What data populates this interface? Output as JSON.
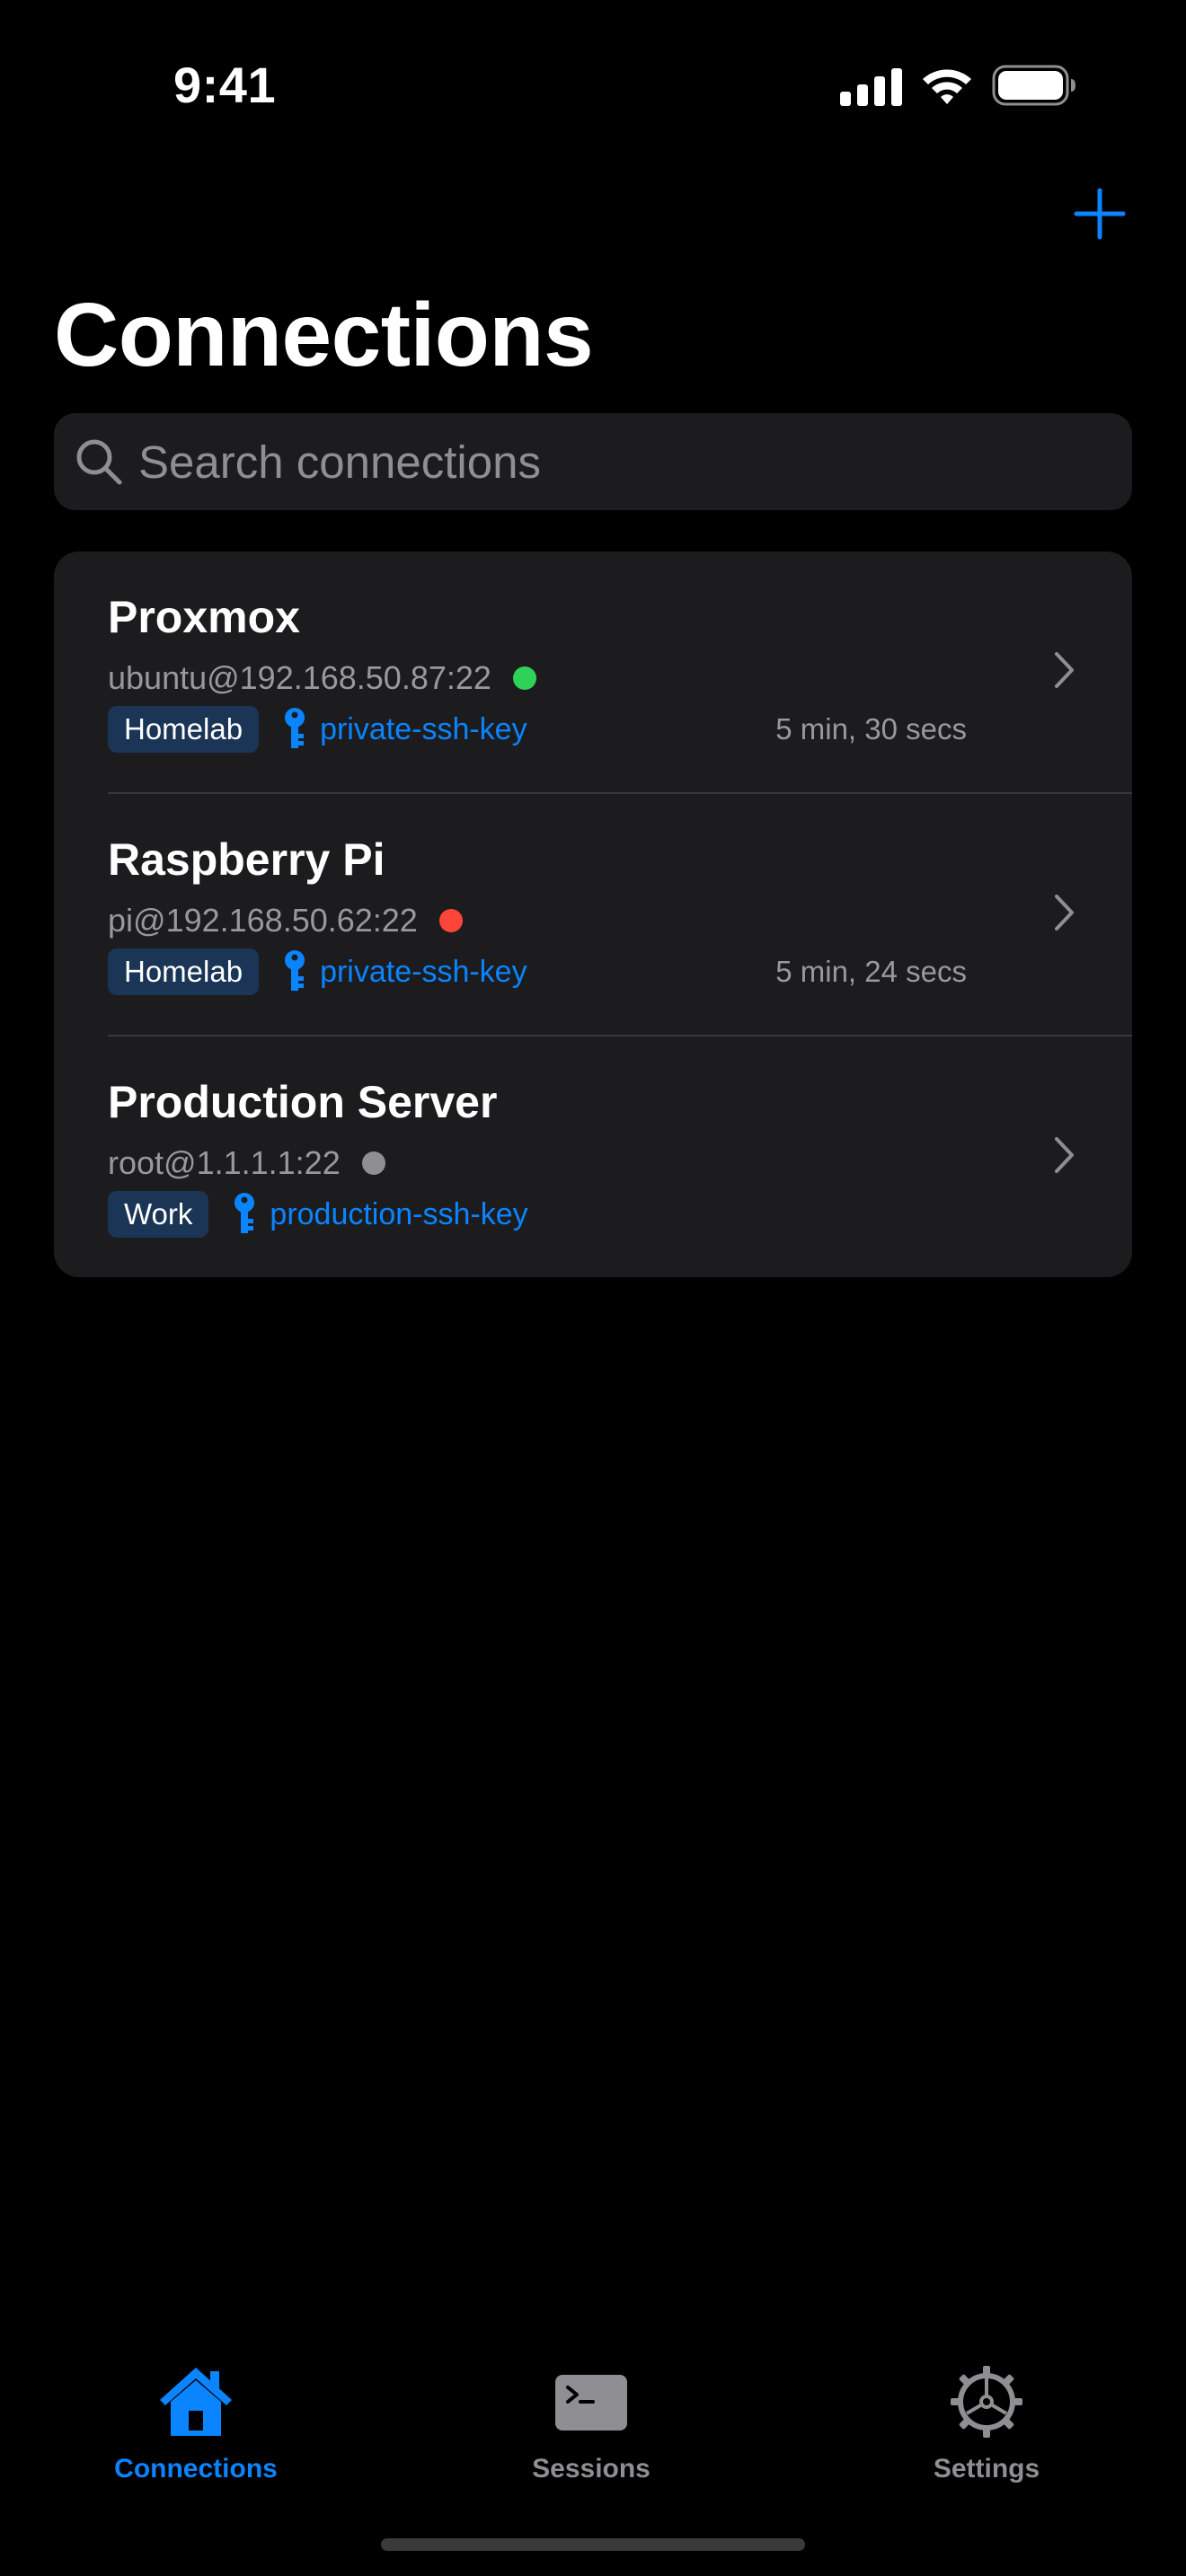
{
  "status_bar": {
    "time": "9:41"
  },
  "nav": {
    "title": "Connections",
    "add_icon": "plus-icon",
    "accent_color": "#0a84ff"
  },
  "search": {
    "placeholder": "Search connections",
    "value": ""
  },
  "connections": [
    {
      "name": "Proxmox",
      "address": "ubuntu@192.168.50.87:22",
      "status": "online",
      "status_color": "#30d158",
      "tag": "Homelab",
      "key": "private-ssh-key",
      "time": "5 min, 30 secs"
    },
    {
      "name": "Raspberry Pi",
      "address": "pi@192.168.50.62:22",
      "status": "offline",
      "status_color": "#ff453a",
      "tag": "Homelab",
      "key": "private-ssh-key",
      "time": "5 min, 24 secs"
    },
    {
      "name": "Production Server",
      "address": "root@1.1.1.1:22",
      "status": "unknown",
      "status_color": "#8e8e93",
      "tag": "Work",
      "key": "production-ssh-key",
      "time": ""
    }
  ],
  "tab_bar": {
    "active_color": "#0a84ff",
    "inactive_color": "#8e8e93",
    "items": [
      {
        "label": "Connections",
        "icon": "house-icon",
        "active": true
      },
      {
        "label": "Sessions",
        "icon": "terminal-icon",
        "active": false
      },
      {
        "label": "Settings",
        "icon": "gear-icon",
        "active": false
      }
    ]
  }
}
